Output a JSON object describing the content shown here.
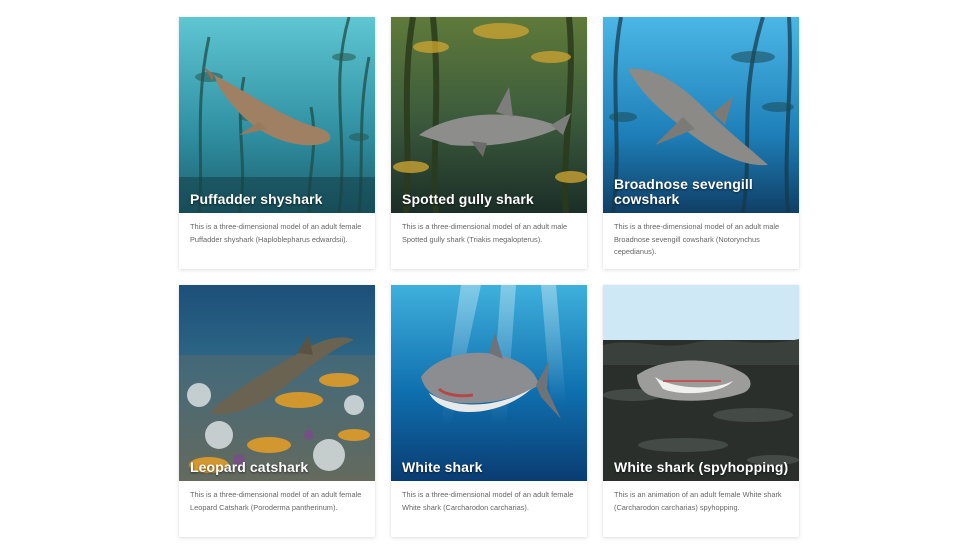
{
  "cards": [
    {
      "title": "Puffadder shyshark",
      "description": "This is a three-dimensional model of an adult female Puffadder shyshark (Haploblepharus edwardsii).",
      "scene": "kelp-teal"
    },
    {
      "title": "Spotted gully shark",
      "description": "This is a three-dimensional model of an adult male Spotted gully shark (Triakis megalopterus).",
      "scene": "kelp-golden"
    },
    {
      "title": "Broadnose sevengill cowshark",
      "description": "This is a three-dimensional model of an adult male Broadnose sevengill cowshark (Notorynchus cepedianus).",
      "scene": "kelp-blue"
    },
    {
      "title": "Leopard catshark",
      "description": "This is a three-dimensional model of an adult female Leopard Catshark (Poroderma pantherinum).",
      "scene": "reef"
    },
    {
      "title": "White shark",
      "description": "This is a three-dimensional model of an adult female White shark (Carcharodon carcharias).",
      "scene": "open-ocean"
    },
    {
      "title": "White shark (spyhopping)",
      "description": "This is an animation of an adult female White shark (Carcharodon carcharias) spyhopping.",
      "scene": "surface"
    }
  ]
}
